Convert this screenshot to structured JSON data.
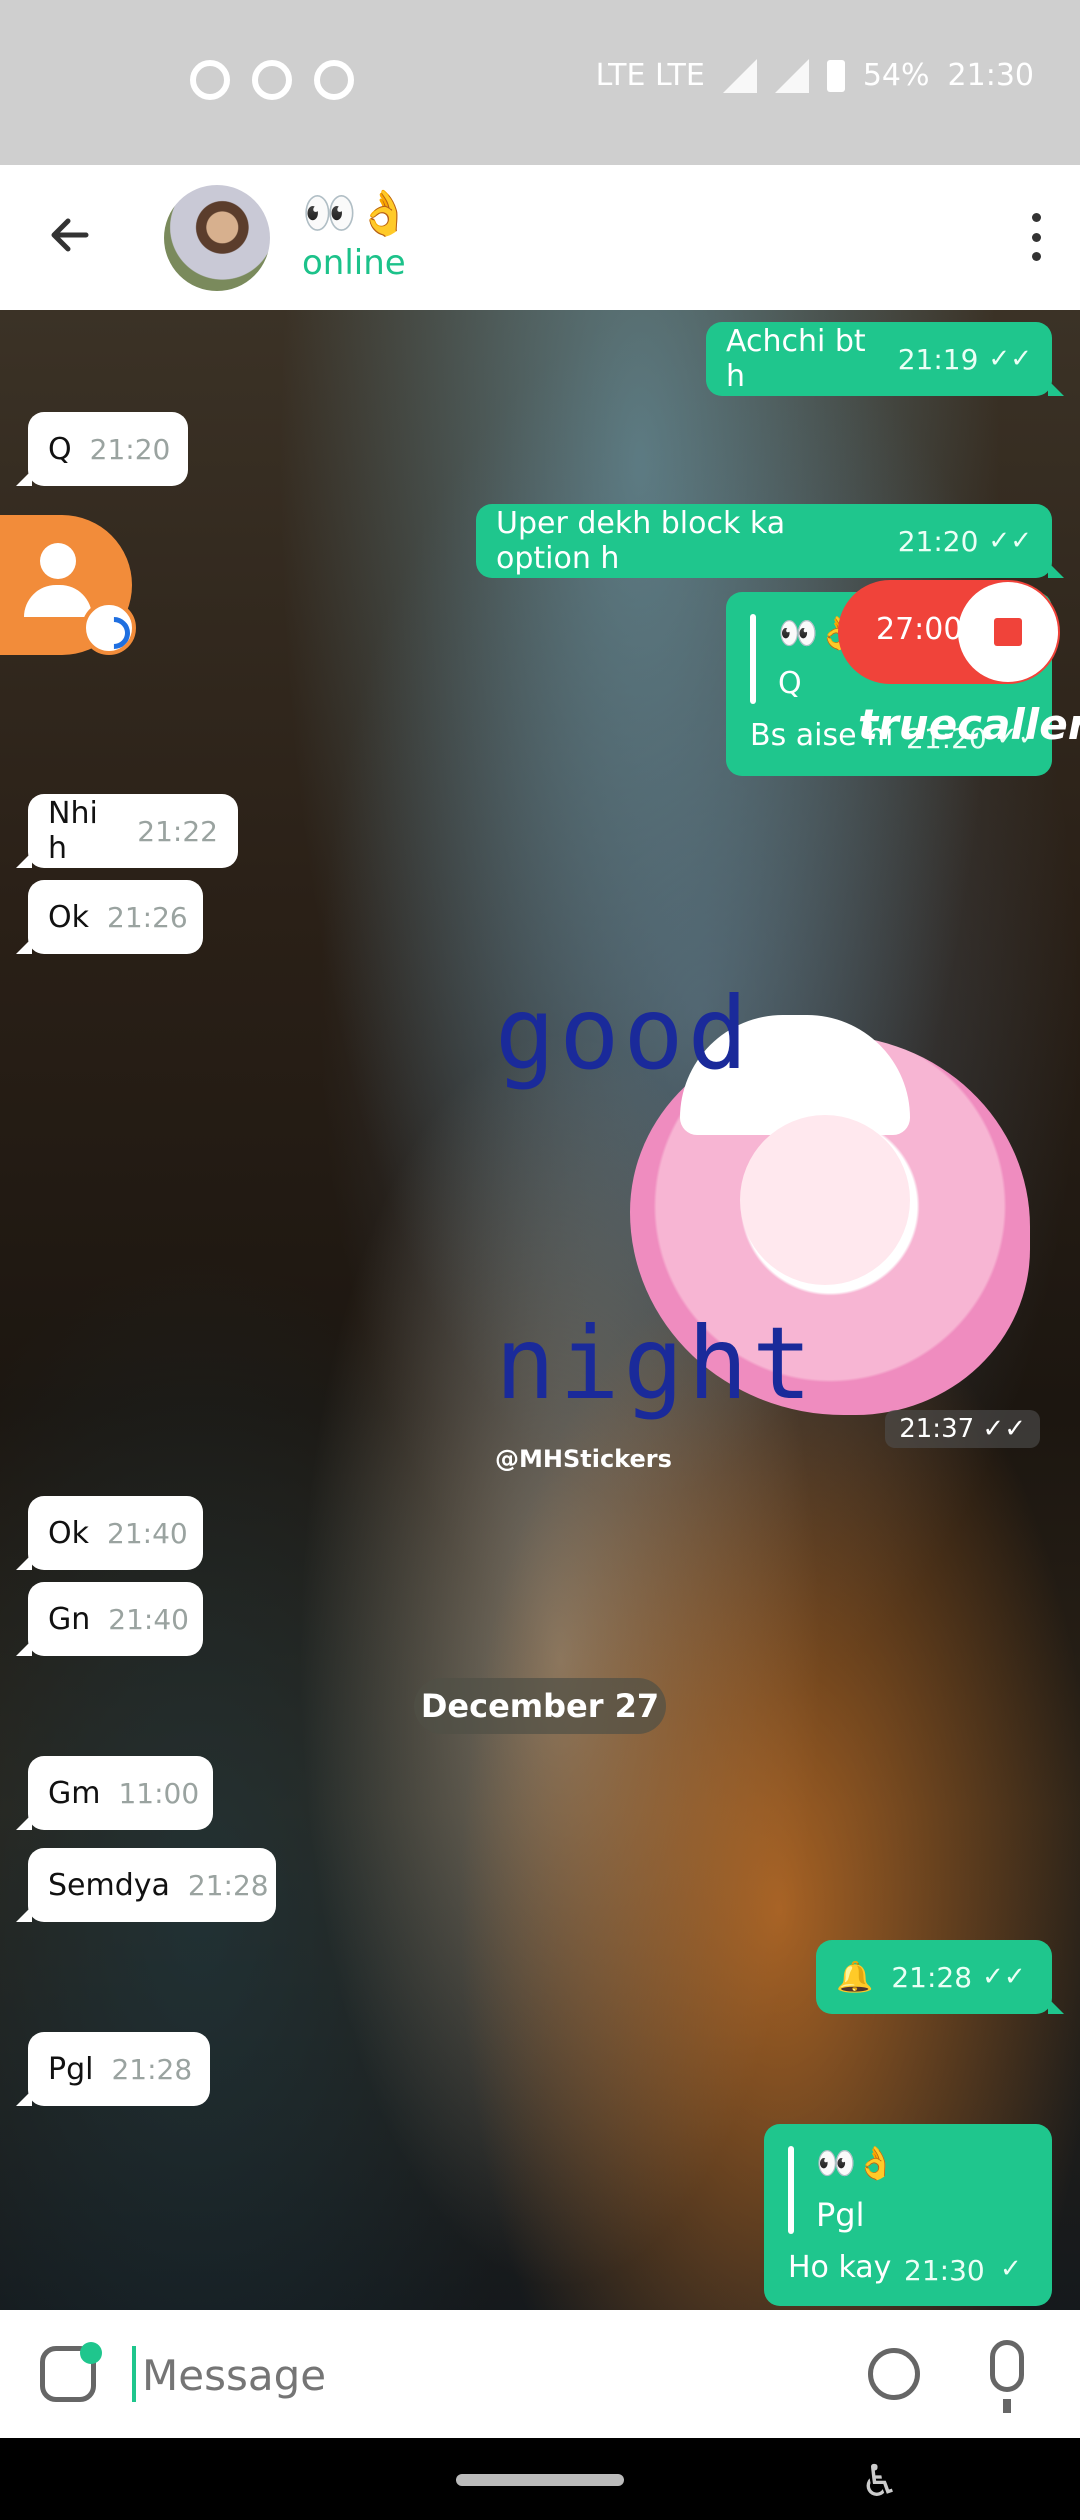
{
  "status_bar": {
    "battery": "54%",
    "time": "21:30",
    "network_labels": "LTE LTE"
  },
  "header": {
    "contact_name": "👀👌",
    "status": "online"
  },
  "messages": [
    {
      "dir": "out",
      "text": "Achchi bt h",
      "time": "21:19",
      "ticks": "✓✓"
    },
    {
      "dir": "in",
      "text": "Q",
      "time": "21:20"
    },
    {
      "dir": "out",
      "text": "Uper dekh block ka option h",
      "time": "21:20",
      "ticks": "✓✓"
    },
    {
      "dir": "out",
      "quote_name": "👀👌",
      "quote_text": "Q",
      "text": "Bs aise hi",
      "time": "21:20",
      "ticks": "✓✓"
    },
    {
      "dir": "in",
      "text": "Nhi h",
      "time": "21:22"
    },
    {
      "dir": "in",
      "text": "Ok",
      "time": "21:26"
    },
    {
      "dir": "in",
      "text": "Ok",
      "time": "21:40"
    },
    {
      "dir": "in",
      "text": "Gn",
      "time": "21:40"
    },
    {
      "dir": "in",
      "text": "Gm",
      "time": "11:00"
    },
    {
      "dir": "in",
      "text": "Semdya",
      "time": "21:28"
    },
    {
      "dir": "out",
      "text": "🔔",
      "time": "21:28",
      "ticks": "✓✓"
    },
    {
      "dir": "in",
      "text": "Pgl",
      "time": "21:28"
    },
    {
      "dir": "out",
      "quote_name": "👀👌",
      "quote_text": "Pgl",
      "text": "Ho kay",
      "time": "21:30",
      "ticks": "✓"
    }
  ],
  "sticker": {
    "word1": "good",
    "word2": "night",
    "handle": "@MHStickers",
    "time": "21:37",
    "ticks": "✓✓"
  },
  "date_separator": "December 27",
  "recorder": {
    "time": "27:00",
    "brand": "truecaller"
  },
  "composer": {
    "placeholder": "Message"
  },
  "icons": [
    "phone-icon",
    "call-icon",
    "call-icon",
    "back-arrow-icon",
    "more-icon",
    "contact-icon",
    "record-stop-icon",
    "sticker-icon",
    "attach-icon",
    "mic-icon",
    "accessibility-icon"
  ]
}
